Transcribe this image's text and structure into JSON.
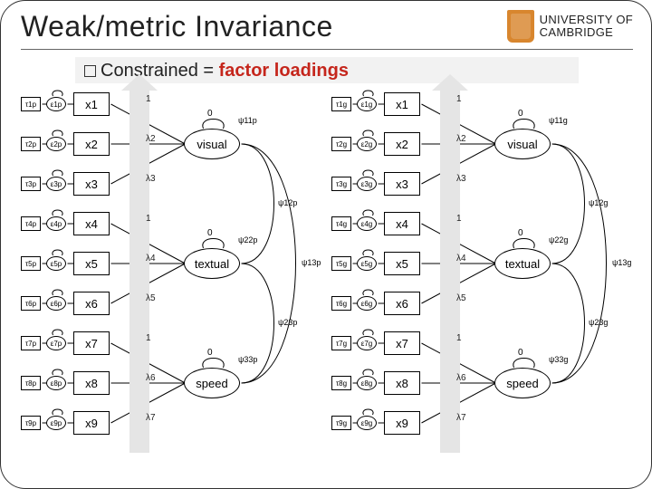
{
  "slide": {
    "title": "Weak/metric Invariance",
    "subtitle_prefix": "Constrained = ",
    "subtitle_key": "factor loadings",
    "university_line1": "UNIVERSITY OF",
    "university_line2": "CAMBRIDGE"
  },
  "groups": [
    {
      "suffix": "p"
    },
    {
      "suffix": "g"
    }
  ],
  "indicators": [
    "x1",
    "x2",
    "x3",
    "x4",
    "x5",
    "x6",
    "x7",
    "x8",
    "x9"
  ],
  "factors": [
    {
      "name": "visual",
      "items": [
        0,
        1,
        2
      ],
      "loads": [
        "1",
        "λ2",
        "λ3"
      ]
    },
    {
      "name": "textual",
      "items": [
        3,
        4,
        5
      ],
      "loads": [
        "1",
        "λ4",
        "λ5"
      ]
    },
    {
      "name": "speed",
      "items": [
        6,
        7,
        8
      ],
      "loads": [
        "1",
        "λ6",
        "λ7"
      ]
    }
  ],
  "psi_labels": {
    "p": {
      "f11": "ψ11p",
      "f22": "ψ22p",
      "f33": "ψ33p",
      "f12": "ψ12p",
      "f13": "ψ13p",
      "f23": "ψ23p"
    },
    "g": {
      "f11": "ψ11g",
      "f22": "ψ22g",
      "f33": "ψ33g",
      "f12": "ψ12g",
      "f13": "ψ13g",
      "f23": "ψ23g"
    }
  }
}
